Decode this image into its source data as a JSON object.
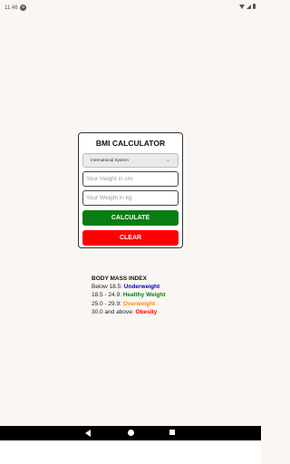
{
  "status_bar": {
    "time": "11:46",
    "notification": "a"
  },
  "card": {
    "title": "BMI CALCULATOR",
    "unit_select": {
      "value": "International System",
      "options": [
        "International System"
      ]
    },
    "height_input": {
      "placeholder": "Your Height in cm",
      "value": ""
    },
    "weight_input": {
      "placeholder": "Your Weight in kg",
      "value": ""
    },
    "calculate_label": "CALCULATE",
    "clear_label": "CLEAR"
  },
  "bmi_info": {
    "heading": "BODY MASS INDEX",
    "ranges": [
      {
        "prefix": "Below 18.5: ",
        "category": "Underweight",
        "color": "#0000aa"
      },
      {
        "prefix": "18.5 - 24.9: ",
        "category": "Healthy Weight",
        "color": "#0a7d12"
      },
      {
        "prefix": "25.0 - 29.9: ",
        "category": "Overweight",
        "color": "#ff8c00"
      },
      {
        "prefix": "30.0 and above: ",
        "category": "Obesity",
        "color": "#ff0000"
      }
    ]
  },
  "colors": {
    "calculate": "#0a7d12",
    "clear": "#ff0000",
    "background": "#faf6f3"
  },
  "icons": {
    "status": [
      "notification-icon",
      "wifi-icon",
      "signal-icon",
      "battery-icon"
    ],
    "navigation": [
      "back-icon",
      "home-icon",
      "recents-icon"
    ]
  }
}
